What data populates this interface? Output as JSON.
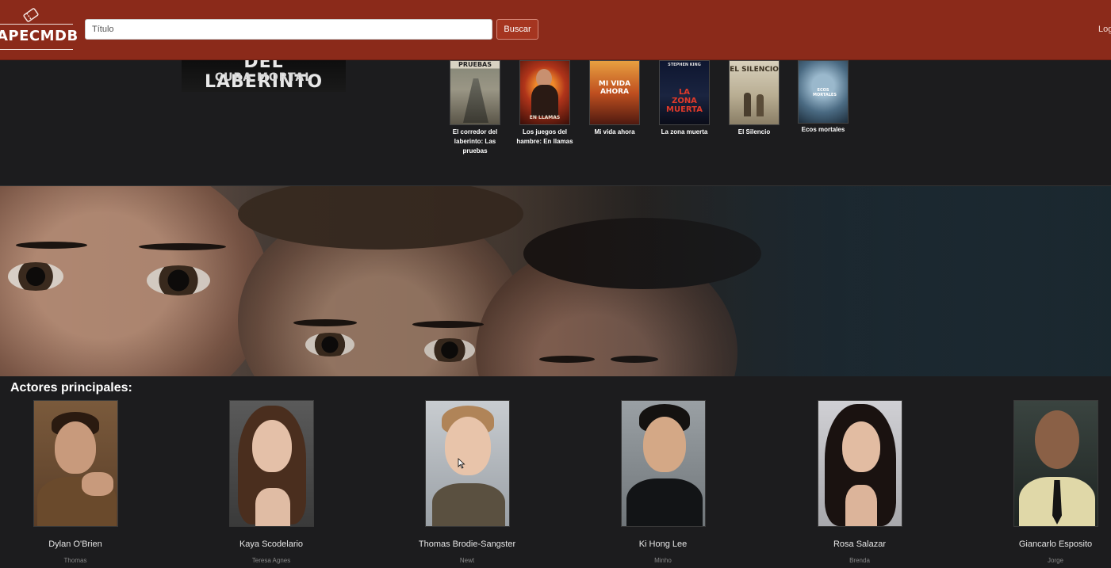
{
  "header": {
    "logo_text": "APECMDB",
    "search_placeholder": "Título",
    "search_button": "Buscar",
    "login_link": "Login"
  },
  "movie": {
    "poster_line1": "DEL LABERINTO",
    "poster_line2": "CURA MORTAL"
  },
  "recommendations": [
    {
      "title": "El corredor del laberinto: Las pruebas",
      "poster_text": "PRUEBAS"
    },
    {
      "title": "Los juegos del hambre: En llamas",
      "poster_text": "EN LLAMAS"
    },
    {
      "title": "Mi vida ahora",
      "poster_text": "MI VIDA AHORA"
    },
    {
      "title": "La zona muerta",
      "poster_text": "LA ZONA MUERTA",
      "poster_author": "STEPHEN KING"
    },
    {
      "title": "El Silencio",
      "poster_text": "EL SILENCIO"
    },
    {
      "title": "Ecos mortales",
      "poster_text": "ECOS MORTALES"
    }
  ],
  "actors_section": {
    "title": "Actores principales:",
    "actors": [
      {
        "name": "Dylan O'Brien",
        "role": "Thomas"
      },
      {
        "name": "Kaya Scodelario",
        "role": "Teresa Agnes"
      },
      {
        "name": "Thomas Brodie-Sangster",
        "role": "Newt"
      },
      {
        "name": "Ki Hong Lee",
        "role": "Minho"
      },
      {
        "name": "Rosa Salazar",
        "role": "Brenda"
      },
      {
        "name": "Giancarlo Esposito",
        "role": "Jorge"
      }
    ]
  },
  "colors": {
    "header_bg": "#8b2a1a",
    "page_bg": "#1c1c1e",
    "button_bg": "#a53520"
  },
  "icons": {
    "logo": "ticket-icon"
  }
}
